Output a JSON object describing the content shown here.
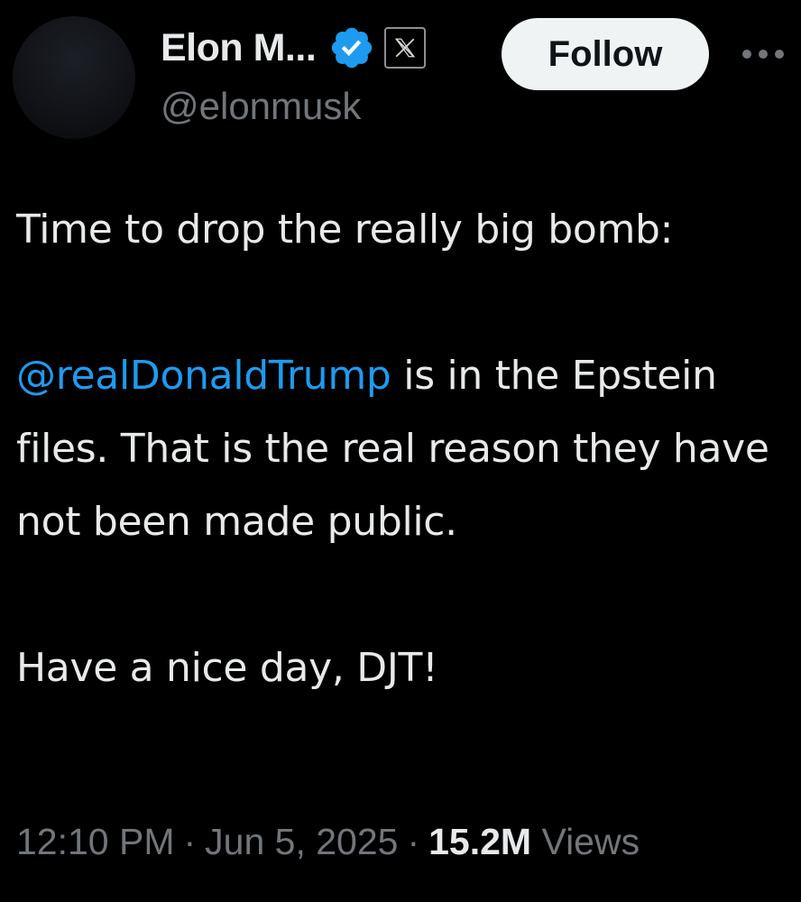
{
  "author": {
    "display_name": "Elon M...",
    "handle": "@elonmusk",
    "verified": true,
    "affiliate_badge": "x-logo-icon"
  },
  "actions": {
    "follow_label": "Follow",
    "more_icon": "more-horizontal-icon"
  },
  "tweet": {
    "line1": "Time to drop the really big bomb:",
    "mention": "@realDonaldTrump",
    "after_mention": " is in the Epstein files. That is the real reason they have not been made public.",
    "closing": "Have a nice day, DJT!"
  },
  "meta": {
    "time": "12:10 PM",
    "date": "Jun 5, 2025",
    "separator": "·",
    "views_count": "15.2M",
    "views_label": "Views"
  },
  "colors": {
    "background": "#000000",
    "text_primary": "#e7e9ea",
    "text_secondary": "#71767b",
    "link": "#1d9bf0",
    "verified_badge": "#1d9bf0",
    "follow_button_bg": "#eff3f4"
  }
}
